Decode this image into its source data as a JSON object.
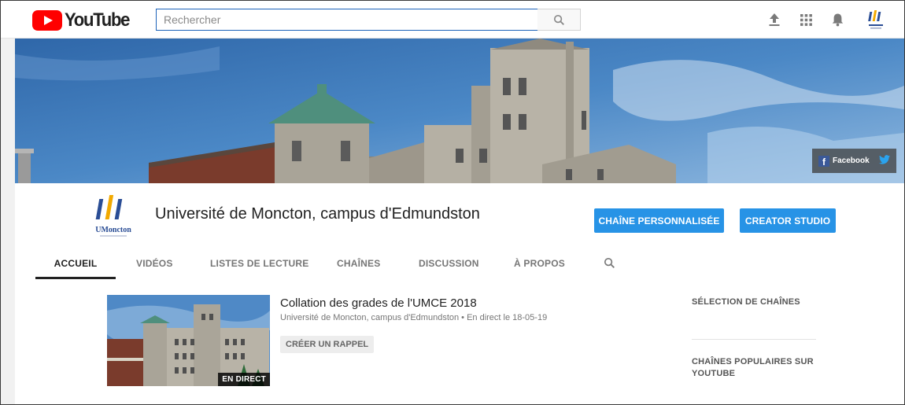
{
  "topbar": {
    "logo_text": "YouTube",
    "search_placeholder": "Rechercher",
    "icons": [
      "upload-icon",
      "apps-grid-icon",
      "notifications-bell-icon",
      "account-avatar-icon"
    ]
  },
  "banner": {
    "social": {
      "facebook_label": "Facebook",
      "icons": [
        "facebook-icon",
        "twitter-icon"
      ]
    }
  },
  "channel": {
    "name": "Université de Moncton, campus d'Edmundston",
    "avatar_text": "UMoncton",
    "buttons": {
      "customize": "CHAÎNE PERSONNALISÉE",
      "studio": "CREATOR STUDIO"
    },
    "tabs": [
      {
        "label": "ACCUEIL",
        "active": true
      },
      {
        "label": "VIDÉOS"
      },
      {
        "label": "LISTES DE LECTURE"
      },
      {
        "label": "CHAÎNES"
      },
      {
        "label": "DISCUSSION"
      },
      {
        "label": "À PROPOS"
      }
    ]
  },
  "featured": {
    "title": "Collation des grades de l'UMCE 2018",
    "meta": "Université de Moncton, campus d'Edmundston • En direct le 18-05-19",
    "badge": "EN DIRECT",
    "reminder_label": "CRÉER UN RAPPEL"
  },
  "sidebar": {
    "section1": "SÉLECTION DE CHAÎNES",
    "section2_line1": "CHAÎNES POPULAIRES SUR",
    "section2_line2": "YOUTUBE"
  },
  "colors": {
    "accent_blue": "#2793e6",
    "youtube_red": "#ff0000",
    "search_border": "#1c62b9"
  }
}
